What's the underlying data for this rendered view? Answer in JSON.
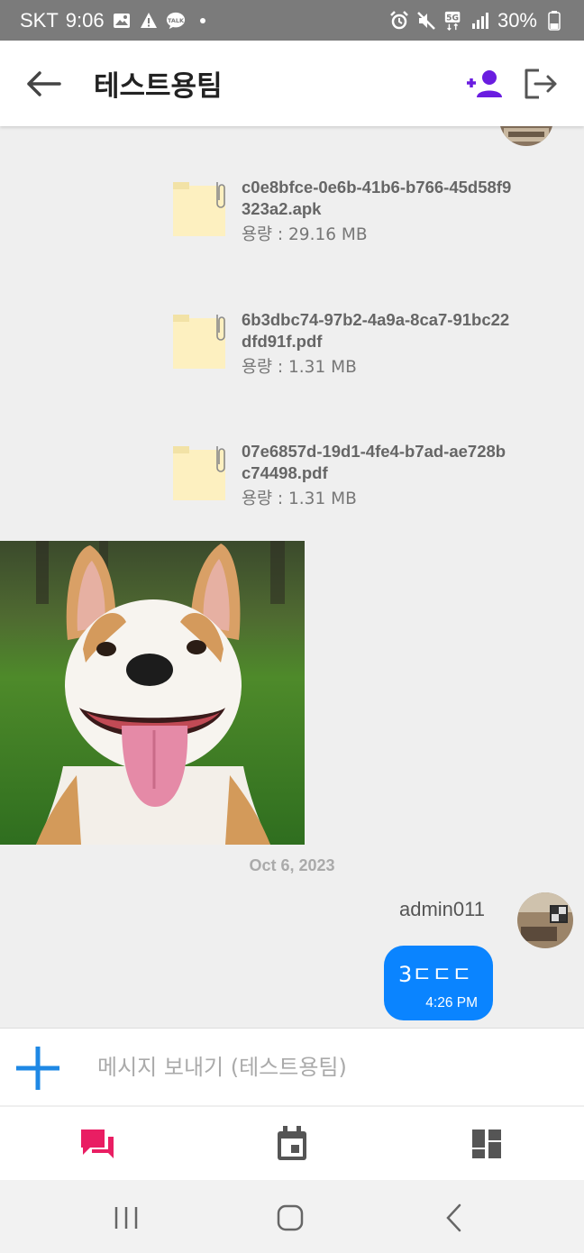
{
  "status_bar": {
    "carrier": "SKT",
    "time": "9:06",
    "battery": "30%",
    "network": "5G",
    "left_icons": [
      "image-icon",
      "warning-icon",
      "talk-icon",
      "dot-icon"
    ],
    "right_icons": [
      "alarm-icon",
      "mute-icon",
      "5g-icon",
      "signal-icon",
      "battery-icon"
    ]
  },
  "header": {
    "title": "테스트용팀",
    "add_icon_color": "#6a1de0"
  },
  "messages": {
    "files": [
      {
        "name": "c0e8bfce-0e6b-41b6-b766-45d58f9323a2.apk",
        "size": "용량 : 29.16 MB"
      },
      {
        "name": "6b3dbc74-97b2-4a9a-8ca7-91bc22dfd91f.pdf",
        "size": "용량 : 1.31 MB"
      },
      {
        "name": "07e6857d-19d1-4fe4-b7ad-ae728bc74498.pdf",
        "size": "용량 : 1.31 MB"
      }
    ],
    "date_separator": "Oct 6, 2023",
    "sender": "admin011",
    "bubble": {
      "text": "3ㄷㄷㄷ",
      "time": "4:26 PM",
      "color": "#0a84ff"
    }
  },
  "composer": {
    "placeholder": "메시지 보내기 (테스트용팀)",
    "plus_color": "#1e88e5"
  },
  "bottom_nav": {
    "items": [
      "chat-icon",
      "calendar-icon",
      "dashboard-icon"
    ],
    "active_color": "#e91e63",
    "inactive_color": "#555555"
  },
  "system_nav": [
    "recent-apps-icon",
    "home-icon",
    "back-icon"
  ]
}
